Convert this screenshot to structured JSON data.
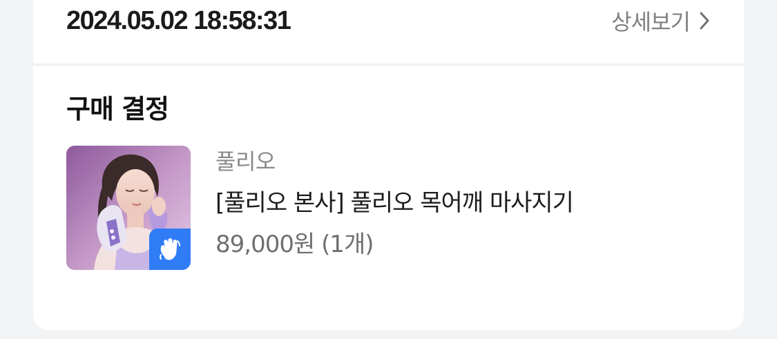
{
  "order": {
    "date": "2024.05.02 18:58:31",
    "detail_label": "상세보기"
  },
  "section": {
    "title": "구매 결정"
  },
  "product": {
    "brand": "풀리오",
    "name": "[풀리오 본사] 풀리오 목어깨 마사지기",
    "price": "89,000원",
    "quantity": "(1개)",
    "thumbnail_icon": "product-photo",
    "badge_icon": "waving-hand-icon",
    "badge_color": "#2f7cf6"
  }
}
